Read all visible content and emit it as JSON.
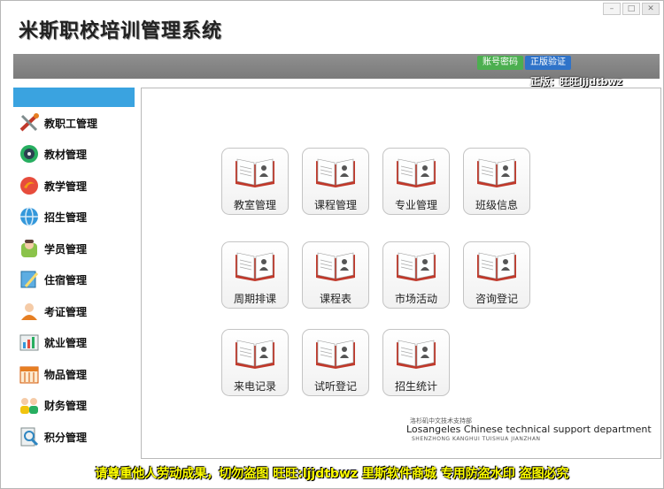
{
  "app": {
    "title": "米斯职校培训管理系统"
  },
  "window_controls": {
    "minimize": "–",
    "maximize": "□",
    "close": "✕"
  },
  "topbar": {
    "btn_account": "账号密码",
    "btn_verify": "正版验证",
    "version_text": "正版：旺旺ljjdtbwz"
  },
  "sidebar": {
    "items": [
      {
        "label": "教职工管理",
        "icon": "tools-icon"
      },
      {
        "label": "教材管理",
        "icon": "disc-icon"
      },
      {
        "label": "教学管理",
        "icon": "swirl-icon"
      },
      {
        "label": "招生管理",
        "icon": "globe-icon"
      },
      {
        "label": "学员管理",
        "icon": "person-icon"
      },
      {
        "label": "住宿管理",
        "icon": "pencil-icon"
      },
      {
        "label": "考证管理",
        "icon": "user-icon"
      },
      {
        "label": "就业管理",
        "icon": "chart-icon"
      },
      {
        "label": "物品管理",
        "icon": "calendar-icon"
      },
      {
        "label": "财务管理",
        "icon": "group-icon"
      },
      {
        "label": "积分管理",
        "icon": "magnifier-icon"
      }
    ]
  },
  "tiles": [
    {
      "label": "教室管理"
    },
    {
      "label": "课程管理"
    },
    {
      "label": "专业管理"
    },
    {
      "label": "班级信息"
    },
    {
      "label": "周期排课"
    },
    {
      "label": "课程表"
    },
    {
      "label": "市场活动"
    },
    {
      "label": "咨询登记"
    },
    {
      "label": "来电记录"
    },
    {
      "label": "试听登记"
    },
    {
      "label": "招生统计"
    }
  ],
  "credits": {
    "line1": "洛杉矶中文技术支持部",
    "line2": "Losangeles Chinese technical support department",
    "line3": "SHENZHONG KANGHUI TUISHUA JIANZHAN"
  },
  "footer": {
    "text": "请尊重他人劳动成果，切勿盗图 旺旺:ljjdtbwz 里斯软件商城 专用防盗水印 盗图必究"
  }
}
